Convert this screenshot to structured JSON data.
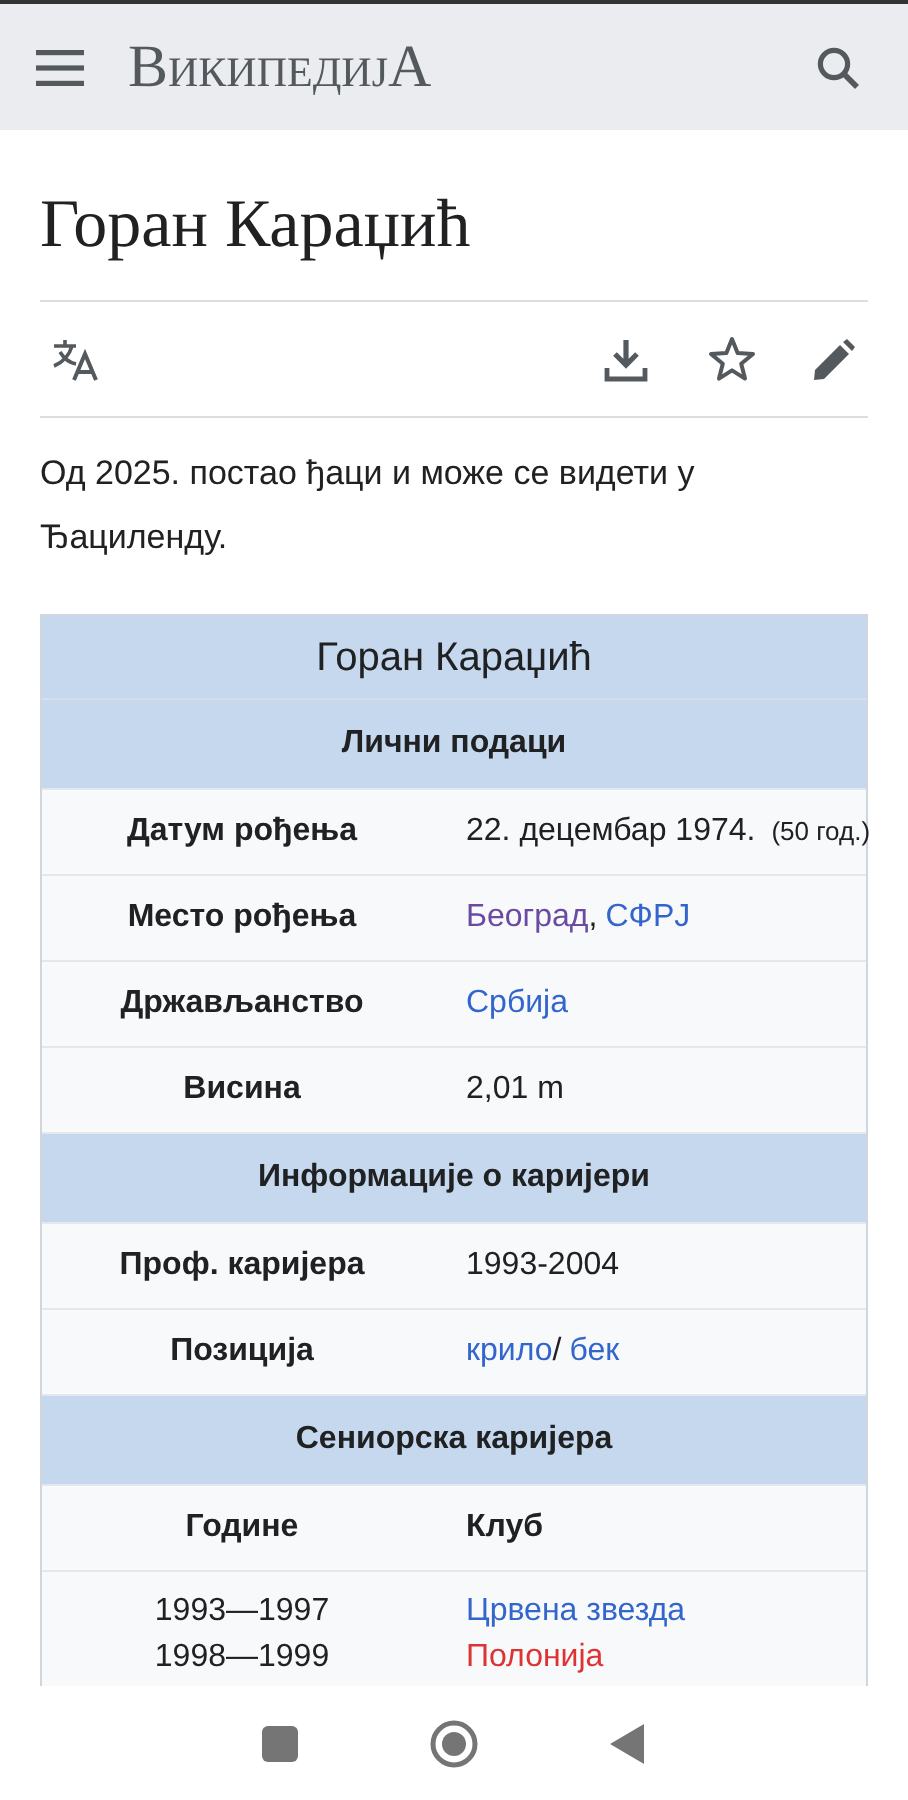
{
  "top_bar": {
    "logo": "ВикипедијА"
  },
  "page_title": "Горан Караџић",
  "intro": "Од 2025. постао ђаци и може се видети у Ђациленду.",
  "infobox": {
    "title": "Горан Караџић",
    "rows": [
      {
        "kind": "header",
        "text": "Лични подаци"
      },
      {
        "kind": "field",
        "label": "Датум рођења",
        "value": [
          {
            "kind": "text",
            "text": "22. децембар 1974."
          },
          {
            "kind": "note",
            "text": "(50 год.)"
          }
        ]
      },
      {
        "kind": "field",
        "label": "Место рођења",
        "value": [
          {
            "kind": "visited",
            "text": "Београд"
          },
          {
            "kind": "text",
            "text": ","
          },
          {
            "kind": "link",
            "text": "СФРЈ"
          }
        ]
      },
      {
        "kind": "field",
        "label": "Држављанство",
        "value": [
          {
            "kind": "link",
            "text": "Србија"
          }
        ]
      },
      {
        "kind": "field",
        "label": "Висина",
        "value": [
          {
            "kind": "text",
            "text": "2,01 m"
          }
        ]
      },
      {
        "kind": "header",
        "text": "Информације о каријери"
      },
      {
        "kind": "field",
        "label": "Проф. каријера",
        "value": [
          {
            "kind": "text",
            "text": "1993-2004"
          }
        ]
      },
      {
        "kind": "field",
        "label": "Позиција",
        "value": [
          {
            "kind": "link",
            "text": "крило"
          },
          {
            "kind": "text",
            "text": "/"
          },
          {
            "kind": "link",
            "text": "бек"
          }
        ]
      },
      {
        "kind": "header",
        "text": "Сениорска каријера"
      },
      {
        "kind": "columns",
        "cells": [
          "Године",
          "Клуб"
        ]
      },
      {
        "kind": "career",
        "years": [
          "1993—1997",
          "1998—1999"
        ],
        "clubs": [
          {
            "kind": "link",
            "text": "Црвена звезда"
          },
          {
            "kind": "redlink",
            "text": "Полонија"
          }
        ]
      }
    ]
  }
}
